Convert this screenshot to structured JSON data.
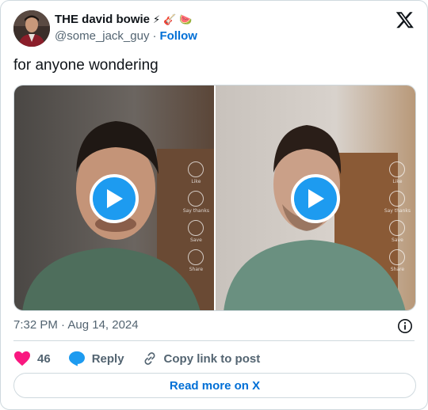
{
  "author": {
    "display_name": "THE david bowie",
    "name_emojis": [
      "⚡",
      "🎸",
      "🍉"
    ],
    "handle": "@some_jack_guy",
    "separator": "·",
    "follow_label": "Follow",
    "avatar_icon": "profile-avatar"
  },
  "logo_icon": "x-logo",
  "tweet": {
    "text": "for anyone wondering"
  },
  "media": {
    "videos": [
      {
        "play_icon": "play-icon",
        "side_labels": [
          "Like",
          "Say thanks",
          "Save",
          "Share"
        ]
      },
      {
        "play_icon": "play-icon",
        "side_labels": [
          "Like",
          "Say thanks",
          "Save",
          "Share"
        ]
      }
    ]
  },
  "timestamp": "7:32 PM · Aug 14, 2024",
  "actions": {
    "like_count": "46",
    "reply_label": "Reply",
    "copy_label": "Copy link to post"
  },
  "read_more_label": "Read more on X",
  "colors": {
    "accent": "#1d9bf0",
    "link": "#006fd6",
    "heart": "#f91880",
    "muted": "#536471",
    "border": "#cfd9de"
  }
}
